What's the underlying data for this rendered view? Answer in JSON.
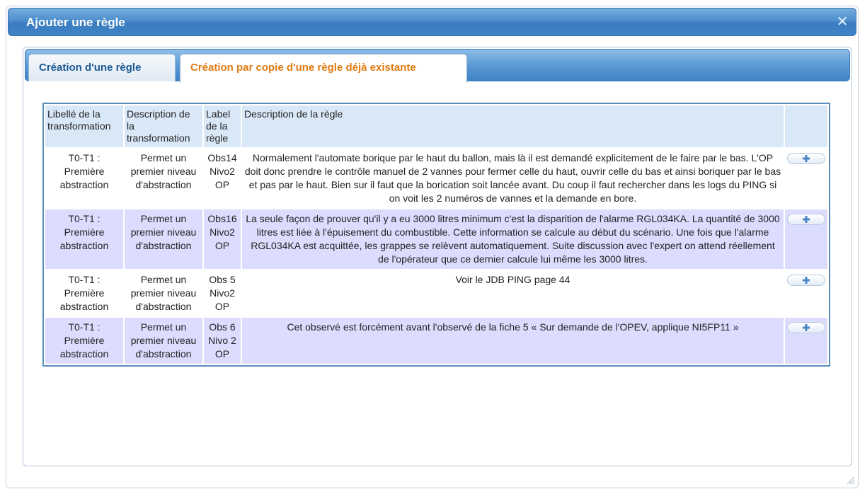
{
  "dialog": {
    "title": "Ajouter une règle",
    "close_icon": "close-icon"
  },
  "tabs": [
    {
      "label": "Création d'une règle",
      "active": false
    },
    {
      "label": "Création par copie d'une règle déjà existante",
      "active": true
    }
  ],
  "table": {
    "headers": [
      "Libellé de la transformation",
      "Description de la transformation",
      "Label de la règle",
      "Description de la règle",
      ""
    ],
    "rows": [
      {
        "libelle": "T0-T1 : Première abstraction",
        "description_transformation": "Permet un premier niveau d'abstraction",
        "label_regle": "Obs14 Nivo2 OP",
        "description_regle": "Normalement l'automate borique par le haut du ballon, mais là il est demandé explicitement de le faire par le bas. L'OP doit donc prendre le contrôle manuel de 2 vannes pour fermer celle du haut, ouvrir celle du bas et ainsi boriquer par le bas et pas par le haut. Bien sur il faut que la borication soit lancée avant. Du coup il faut rechercher dans les logs du PING si on voit les 2 numéros de vannes et la demande en bore."
      },
      {
        "libelle": "T0-T1 : Première abstraction",
        "description_transformation": "Permet un premier niveau d'abstraction",
        "label_regle": "Obs16 Nivo2 OP",
        "description_regle": "La seule façon de prouver qu'il y a eu 3000 litres minimum c'est la disparition de l'alarme RGL034KA. La quantité de 3000 litres est liée à l'épuisement du combustible. Cette information se calcule au début du scénario. Une fois que l'alarme RGL034KA est acquittée, les grappes se relèvent automatiquement. Suite discussion avec l'expert on attend réellement de l'opérateur que ce dernier calcule lui même les 3000 litres."
      },
      {
        "libelle": "T0-T1 : Première abstraction",
        "description_transformation": "Permet un premier niveau d'abstraction",
        "label_regle": "Obs 5 Nivo2 OP",
        "description_regle": "Voir le JDB PING page 44"
      },
      {
        "libelle": "T0-T1 : Première abstraction",
        "description_transformation": "Permet un premier niveau d'abstraction",
        "label_regle": "Obs 6 Nivo 2 OP",
        "description_regle": "Cet observé est forcément avant l'observé de la fiche 5 « Sur demande de l'OPEV, applique NI5FP11 »"
      }
    ],
    "row_action_icon": "plus-icon"
  },
  "colors": {
    "titlebar": "#4d8ecd",
    "active_tab_text": "#e07b12",
    "tab_text": "#1d5a94",
    "header_bg": "#d9e8f7",
    "even_row_bg": "#dcdcff"
  }
}
